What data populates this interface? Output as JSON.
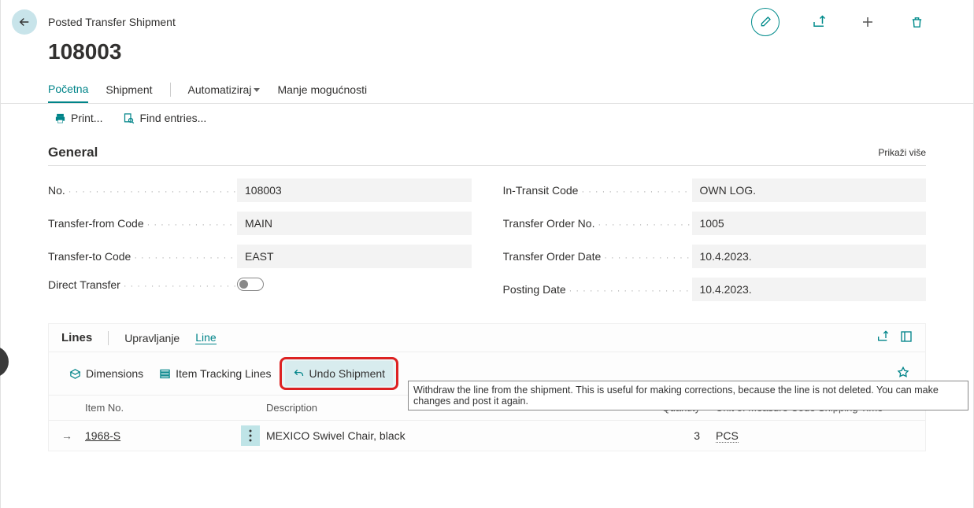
{
  "header": {
    "breadcrumb": "Posted Transfer Shipment",
    "title": "108003"
  },
  "tabs": {
    "home": "Početna",
    "shipment": "Shipment",
    "automate": "Automatiziraj",
    "fewer": "Manje mogućnosti"
  },
  "toolbar": {
    "print": "Print...",
    "find": "Find entries..."
  },
  "general": {
    "title": "General",
    "show_more": "Prikaži više",
    "labels": {
      "no": "No.",
      "tf_code": "Transfer-from Code",
      "tt_code": "Transfer-to Code",
      "direct": "Direct Transfer",
      "intransit": "In-Transit Code",
      "order_no": "Transfer Order No.",
      "order_date": "Transfer Order Date",
      "posting_date": "Posting Date"
    },
    "values": {
      "no": "108003",
      "tf_code": "MAIN",
      "tt_code": "EAST",
      "intransit": "OWN LOG.",
      "order_no": "1005",
      "order_date": "10.4.2023.",
      "posting_date": "10.4.2023."
    }
  },
  "lines": {
    "title": "Lines",
    "manage": "Upravljanje",
    "line_tab": "Line",
    "tools": {
      "dimensions": "Dimensions",
      "tracking": "Item Tracking Lines",
      "undo": "Undo Shipment"
    },
    "tooltip": "Withdraw the line from the shipment. This is useful for making corrections, because the line is not deleted. You can make changes and post it again.",
    "columns": {
      "item": "Item No.",
      "desc": "Description",
      "qty": "Quantity",
      "uom": "Unit of Measure Code",
      "ship": "Shipping Time"
    },
    "row": {
      "item": "1968-S",
      "desc": "MEXICO Swivel Chair, black",
      "qty": "3",
      "uom": "PCS"
    }
  }
}
